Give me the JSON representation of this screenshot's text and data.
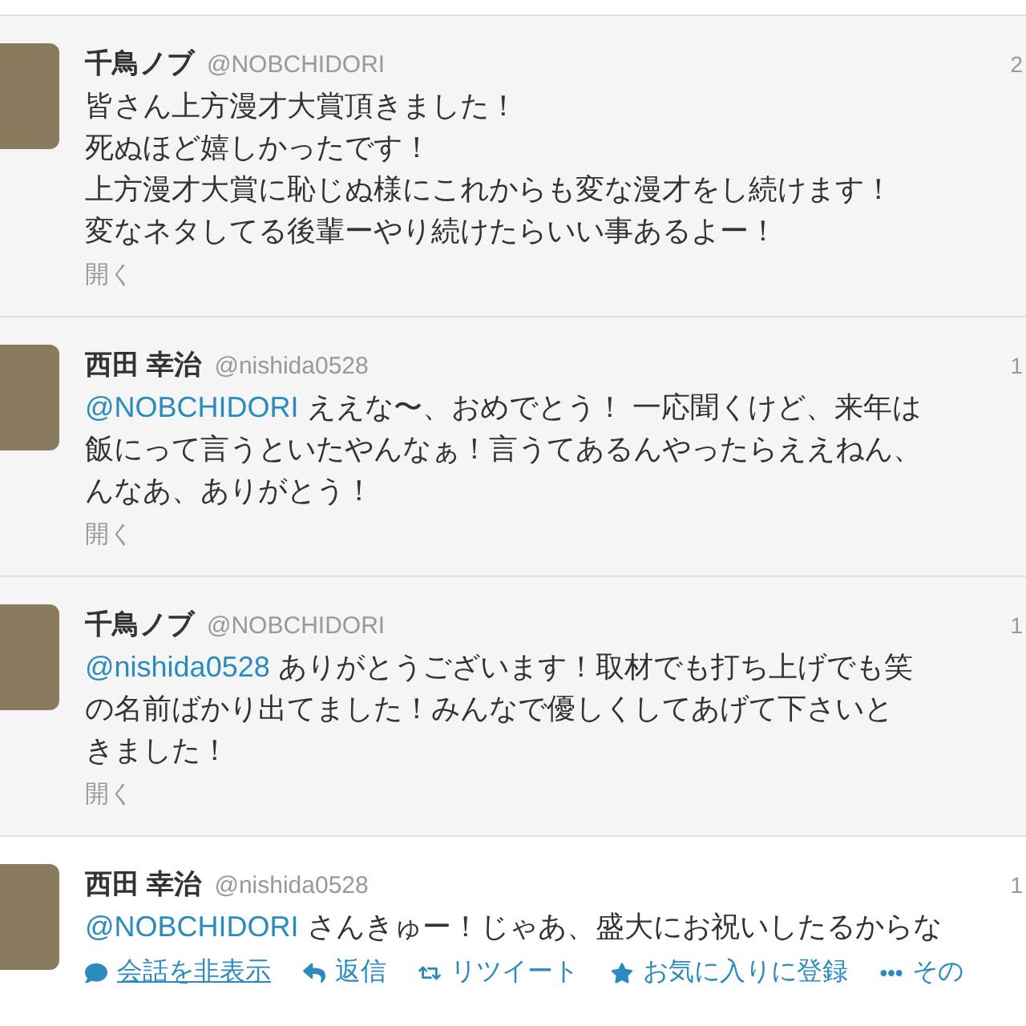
{
  "tweets": [
    {
      "name": "千鳥ノブ",
      "handle": "@NOBCHIDORI",
      "time": "2",
      "highlighted": true,
      "lines": [
        {
          "text": "皆さん上方漫才大賞頂きました！"
        },
        {
          "text": "死ぬほど嬉しかったです！"
        },
        {
          "text": "上方漫才大賞に恥じぬ様にこれからも変な漫才をし続けます！"
        },
        {
          "text": "変なネタしてる後輩ーやり続けたらいい事あるよー！"
        }
      ],
      "expand": "開く"
    },
    {
      "name": "西田 幸治",
      "handle": "@nishida0528",
      "time": "1",
      "highlighted": true,
      "lines": [
        {
          "mention": "@NOBCHIDORI",
          "text": " ええな〜、おめでとう！ 一応聞くけど、来年は"
        },
        {
          "text": "飯にって言うといたやんなぁ！言うてあるんやったらええねん、"
        },
        {
          "text": "んなあ、ありがとう！"
        }
      ],
      "expand": "開く"
    },
    {
      "name": "千鳥ノブ",
      "handle": "@NOBCHIDORI",
      "time": "1",
      "highlighted": true,
      "lines": [
        {
          "mention": "@nishida0528",
          "text": " ありがとうございます！取材でも打ち上げでも笑"
        },
        {
          "text": "の名前ばかり出てました！みんなで優しくしてあげて下さいと"
        },
        {
          "text": "きました！"
        }
      ],
      "expand": "開く"
    },
    {
      "name": "西田 幸治",
      "handle": "@nishida0528",
      "time": "1",
      "highlighted": false,
      "lines": [
        {
          "mention": "@NOBCHIDORI",
          "text": " さんきゅー！じゃあ、盛大にお祝いしたるからな"
        }
      ],
      "actions": [
        {
          "kind": "conversation",
          "label": "会話を非表示"
        },
        {
          "kind": "reply",
          "label": "返信"
        },
        {
          "kind": "retweet",
          "label": "リツイート"
        },
        {
          "kind": "favorite",
          "label": "お気に入りに登録"
        },
        {
          "kind": "more",
          "label": "その"
        }
      ]
    }
  ]
}
